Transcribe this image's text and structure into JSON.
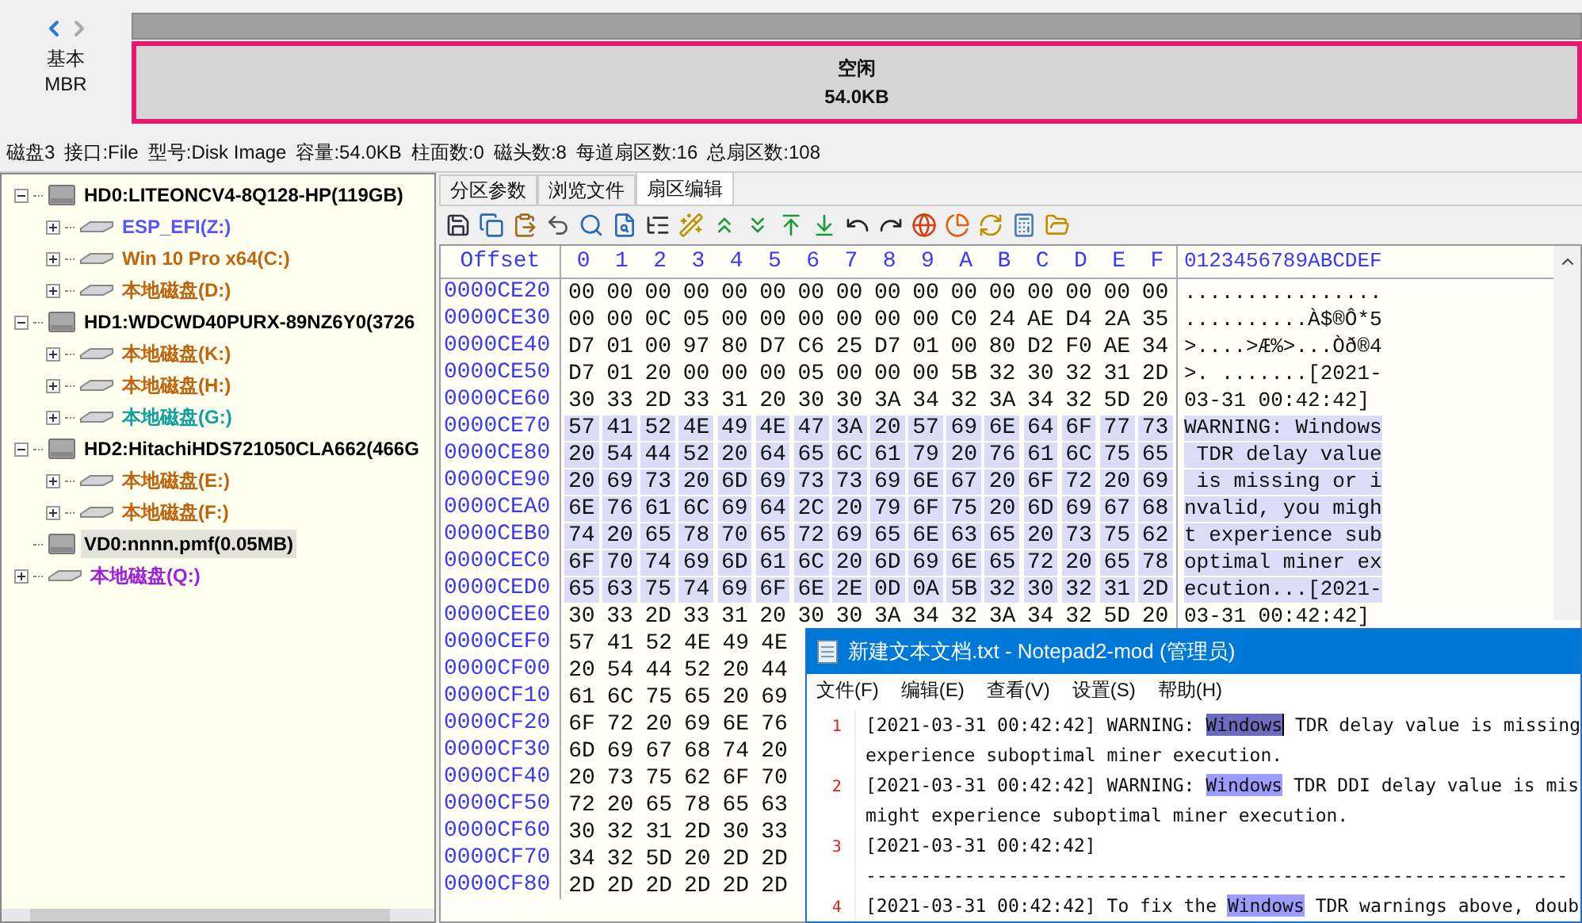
{
  "nav": {
    "mode": "基本",
    "scheme": "MBR"
  },
  "partition_bar": {
    "label": "空闲",
    "size": "54.0KB"
  },
  "disk_info": [
    "磁盘3",
    "接口:File",
    "型号:Disk Image",
    "容量:54.0KB",
    "柱面数:0",
    "磁头数:8",
    "每道扇区数:16",
    "总扇区数:108"
  ],
  "tree": [
    {
      "kind": "disk",
      "label": "HD0:LITEONCV4-8Q128-HP(119GB)",
      "color": "#000000",
      "expanded": true,
      "selected": false,
      "children": [
        {
          "kind": "partition",
          "label": "ESP_EFI(Z:)",
          "color": "#5555ff",
          "expanded": false,
          "selected": false
        },
        {
          "kind": "partition",
          "label": "Win 10 Pro x64(C:)",
          "color": "#c0650f",
          "expanded": false,
          "selected": false
        },
        {
          "kind": "partition",
          "label": "本地磁盘(D:)",
          "color": "#c0650f",
          "expanded": false,
          "selected": false
        }
      ]
    },
    {
      "kind": "disk",
      "label": "HD1:WDCWD40PURX-89NZ6Y0(3726",
      "color": "#000000",
      "expanded": true,
      "selected": false,
      "children": [
        {
          "kind": "partition",
          "label": "本地磁盘(K:)",
          "color": "#c0650f",
          "expanded": false,
          "selected": false
        },
        {
          "kind": "partition",
          "label": "本地磁盘(H:)",
          "color": "#c0650f",
          "expanded": false,
          "selected": false
        },
        {
          "kind": "partition",
          "label": "本地磁盘(G:)",
          "color": "#10a0a0",
          "expanded": false,
          "selected": false
        }
      ]
    },
    {
      "kind": "disk",
      "label": "HD2:HitachiHDS721050CLA662(466G",
      "color": "#000000",
      "expanded": true,
      "selected": false,
      "children": [
        {
          "kind": "partition",
          "label": "本地磁盘(E:)",
          "color": "#c0650f",
          "expanded": false,
          "selected": false
        },
        {
          "kind": "partition",
          "label": "本地磁盘(F:)",
          "color": "#c0650f",
          "expanded": false,
          "selected": false
        }
      ]
    },
    {
      "kind": "disk",
      "label": "VD0:nnnn.pmf(0.05MB)",
      "color": "#000000",
      "selected": true
    },
    {
      "kind": "partition",
      "label": "本地磁盘(Q:)",
      "color": "#a020e0",
      "expanded": false,
      "selected": false
    }
  ],
  "tabs": [
    {
      "label": "分区参数",
      "selected": false
    },
    {
      "label": "浏览文件",
      "selected": false
    },
    {
      "label": "扇区编辑",
      "selected": true
    }
  ],
  "hex": {
    "offset_header": "Offset",
    "column_headers": [
      "0",
      "1",
      "2",
      "3",
      "4",
      "5",
      "6",
      "7",
      "8",
      "9",
      "A",
      "B",
      "C",
      "D",
      "E",
      "F"
    ],
    "ascii_header": "0123456789ABCDEF",
    "rows": [
      {
        "offset": "0000CE20",
        "bytes": [
          "00",
          "00",
          "00",
          "00",
          "00",
          "00",
          "00",
          "00",
          "00",
          "00",
          "00",
          "00",
          "00",
          "00",
          "00",
          "00"
        ],
        "ascii": "................",
        "selected": false
      },
      {
        "offset": "0000CE30",
        "bytes": [
          "00",
          "00",
          "0C",
          "05",
          "00",
          "00",
          "00",
          "00",
          "00",
          "00",
          "C0",
          "24",
          "AE",
          "D4",
          "2A",
          "35"
        ],
        "ascii": "..........À$®Ô*5",
        "selected": false
      },
      {
        "offset": "0000CE40",
        "bytes": [
          "D7",
          "01",
          "00",
          "97",
          "80",
          "D7",
          "C6",
          "25",
          "D7",
          "01",
          "00",
          "80",
          "D2",
          "F0",
          "AE",
          "34"
        ],
        "ascii": ">....>Æ%>...Òð®4",
        "selected": false
      },
      {
        "offset": "0000CE50",
        "bytes": [
          "D7",
          "01",
          "20",
          "00",
          "00",
          "00",
          "05",
          "00",
          "00",
          "00",
          "5B",
          "32",
          "30",
          "32",
          "31",
          "2D"
        ],
        "ascii": ">. .......[2021-",
        "selected": false
      },
      {
        "offset": "0000CE60",
        "bytes": [
          "30",
          "33",
          "2D",
          "33",
          "31",
          "20",
          "30",
          "30",
          "3A",
          "34",
          "32",
          "3A",
          "34",
          "32",
          "5D",
          "20"
        ],
        "ascii": "03-31 00:42:42]",
        "selected": false
      },
      {
        "offset": "0000CE70",
        "bytes": [
          "57",
          "41",
          "52",
          "4E",
          "49",
          "4E",
          "47",
          "3A",
          "20",
          "57",
          "69",
          "6E",
          "64",
          "6F",
          "77",
          "73"
        ],
        "ascii": "WARNING: Windows",
        "selected": true
      },
      {
        "offset": "0000CE80",
        "bytes": [
          "20",
          "54",
          "44",
          "52",
          "20",
          "64",
          "65",
          "6C",
          "61",
          "79",
          "20",
          "76",
          "61",
          "6C",
          "75",
          "65"
        ],
        "ascii": " TDR delay value",
        "selected": true
      },
      {
        "offset": "0000CE90",
        "bytes": [
          "20",
          "69",
          "73",
          "20",
          "6D",
          "69",
          "73",
          "73",
          "69",
          "6E",
          "67",
          "20",
          "6F",
          "72",
          "20",
          "69"
        ],
        "ascii": " is missing or i",
        "selected": true
      },
      {
        "offset": "0000CEA0",
        "bytes": [
          "6E",
          "76",
          "61",
          "6C",
          "69",
          "64",
          "2C",
          "20",
          "79",
          "6F",
          "75",
          "20",
          "6D",
          "69",
          "67",
          "68"
        ],
        "ascii": "nvalid, you migh",
        "selected": true
      },
      {
        "offset": "0000CEB0",
        "bytes": [
          "74",
          "20",
          "65",
          "78",
          "70",
          "65",
          "72",
          "69",
          "65",
          "6E",
          "63",
          "65",
          "20",
          "73",
          "75",
          "62"
        ],
        "ascii": "t experience sub",
        "selected": true
      },
      {
        "offset": "0000CEC0",
        "bytes": [
          "6F",
          "70",
          "74",
          "69",
          "6D",
          "61",
          "6C",
          "20",
          "6D",
          "69",
          "6E",
          "65",
          "72",
          "20",
          "65",
          "78"
        ],
        "ascii": "optimal miner ex",
        "selected": true
      },
      {
        "offset": "0000CED0",
        "bytes": [
          "65",
          "63",
          "75",
          "74",
          "69",
          "6F",
          "6E",
          "2E",
          "0D",
          "0A",
          "5B",
          "32",
          "30",
          "32",
          "31",
          "2D"
        ],
        "ascii": "ecution...[2021-",
        "selected": true
      },
      {
        "offset": "0000CEE0",
        "bytes": [
          "30",
          "33",
          "2D",
          "33",
          "31",
          "20",
          "30",
          "30",
          "3A",
          "34",
          "32",
          "3A",
          "34",
          "32",
          "5D",
          "20"
        ],
        "ascii": "03-31 00:42:42]",
        "selected": false
      },
      {
        "offset": "0000CEF0",
        "bytes": [
          "57",
          "41",
          "52",
          "4E",
          "49",
          "4E"
        ],
        "selected": false
      },
      {
        "offset": "0000CF00",
        "bytes": [
          "20",
          "54",
          "44",
          "52",
          "20",
          "44"
        ],
        "selected": false
      },
      {
        "offset": "0000CF10",
        "bytes": [
          "61",
          "6C",
          "75",
          "65",
          "20",
          "69"
        ],
        "selected": false
      },
      {
        "offset": "0000CF20",
        "bytes": [
          "6F",
          "72",
          "20",
          "69",
          "6E",
          "76"
        ],
        "selected": false
      },
      {
        "offset": "0000CF30",
        "bytes": [
          "6D",
          "69",
          "67",
          "68",
          "74",
          "20"
        ],
        "selected": false
      },
      {
        "offset": "0000CF40",
        "bytes": [
          "20",
          "73",
          "75",
          "62",
          "6F",
          "70"
        ],
        "selected": false
      },
      {
        "offset": "0000CF50",
        "bytes": [
          "72",
          "20",
          "65",
          "78",
          "65",
          "63"
        ],
        "selected": false
      },
      {
        "offset": "0000CF60",
        "bytes": [
          "30",
          "32",
          "31",
          "2D",
          "30",
          "33"
        ],
        "selected": false
      },
      {
        "offset": "0000CF70",
        "bytes": [
          "34",
          "32",
          "5D",
          "20",
          "2D",
          "2D"
        ],
        "selected": false
      },
      {
        "offset": "0000CF80",
        "bytes": [
          "2D",
          "2D",
          "2D",
          "2D",
          "2D",
          "2D"
        ],
        "selected": false
      }
    ]
  },
  "notepad": {
    "title": "新建文本文档.txt - Notepad2-mod (管理员)",
    "menu": [
      "文件(F)",
      "编辑(E)",
      "查看(V)",
      "设置(S)",
      "帮助(H)"
    ],
    "lines": [
      {
        "number": "1",
        "rows": [
          [
            {
              "text": "[2021-03-31 00:42:42] WARNING: "
            },
            {
              "text": "Windows",
              "highlighted": true,
              "selected": true
            },
            {
              "text": " TDR delay value is missing"
            }
          ],
          [
            {
              "text": "experience suboptimal miner execution."
            }
          ]
        ]
      },
      {
        "number": "2",
        "rows": [
          [
            {
              "text": "[2021-03-31 00:42:42] WARNING: "
            },
            {
              "text": "Windows",
              "highlighted": true,
              "selected": false
            },
            {
              "text": " TDR DDI delay value is mis"
            }
          ],
          [
            {
              "text": "might experience suboptimal miner execution."
            }
          ]
        ]
      },
      {
        "number": "3",
        "rows": [
          [
            {
              "text": "[2021-03-31 00:42:42]"
            }
          ],
          [
            {
              "text": "----------------------------------------------------------------"
            }
          ]
        ]
      },
      {
        "number": "4",
        "rows": [
          [
            {
              "text": "[2021-03-31 00:42:42] To fix the "
            },
            {
              "text": "Windows",
              "highlighted": true,
              "selected": false
            },
            {
              "text": " TDR warnings above, doub"
            }
          ]
        ]
      }
    ]
  }
}
